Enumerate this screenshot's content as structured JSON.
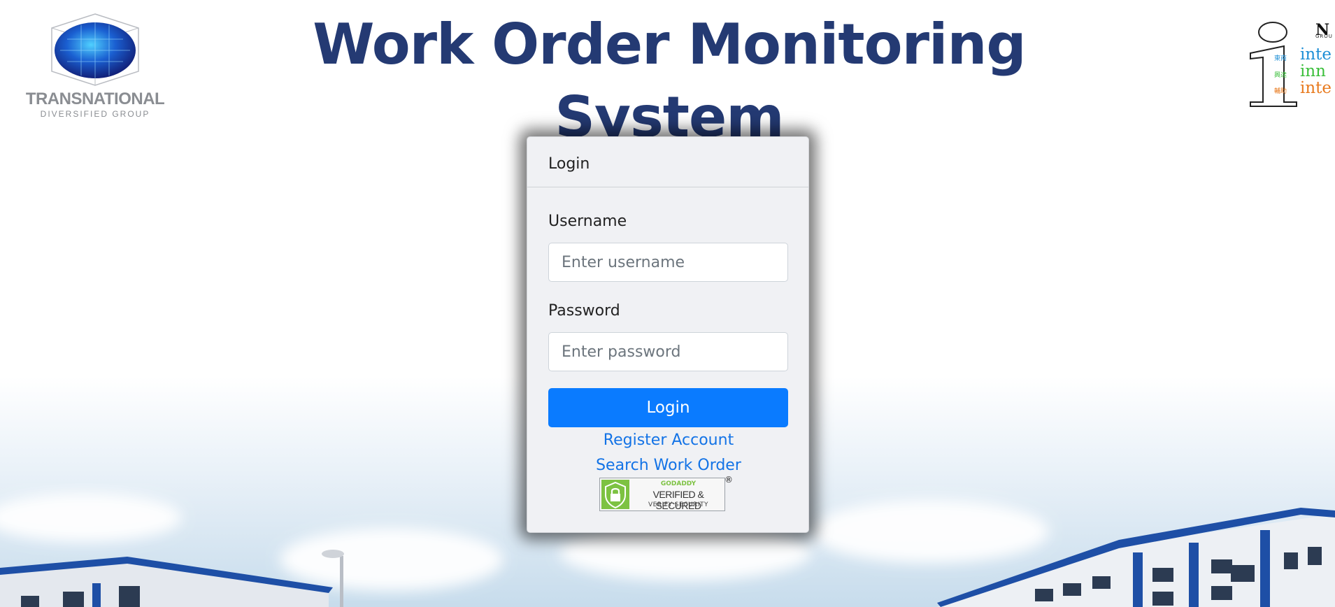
{
  "header": {
    "title": "Work Order Monitoring System",
    "left_logo": {
      "icon": "globe-cube-icon",
      "name": "TRANSNATIONAL",
      "subtitle": "DIVERSIFIED GROUP"
    },
    "right_logo": {
      "icon": "i-letter-icon",
      "top_text": "N",
      "group_text": "GROU",
      "lines": [
        "inte",
        "inn",
        "inte"
      ],
      "tags": [
        "東南",
        "興達",
        "輔助"
      ],
      "colors": [
        "#1e8fd6",
        "#3bbf3b",
        "#e87a1e"
      ]
    }
  },
  "login": {
    "header": "Login",
    "username_label": "Username",
    "username_placeholder": "Enter username",
    "username_value": "",
    "password_label": "Password",
    "password_placeholder": "Enter password",
    "password_value": "",
    "login_button": "Login",
    "register_link": "Register Account",
    "search_link": "Search Work Order",
    "seal": {
      "brand": "GODADDY",
      "title": "VERIFIED & SECURED",
      "subtitle": "VERIFY SECURITY",
      "registered": "®",
      "icon": "padlock-icon"
    }
  },
  "colors": {
    "title": "#243a73",
    "primary_button": "#0a7bff",
    "link": "#1373e6",
    "card_background": "#f0f1f4"
  }
}
